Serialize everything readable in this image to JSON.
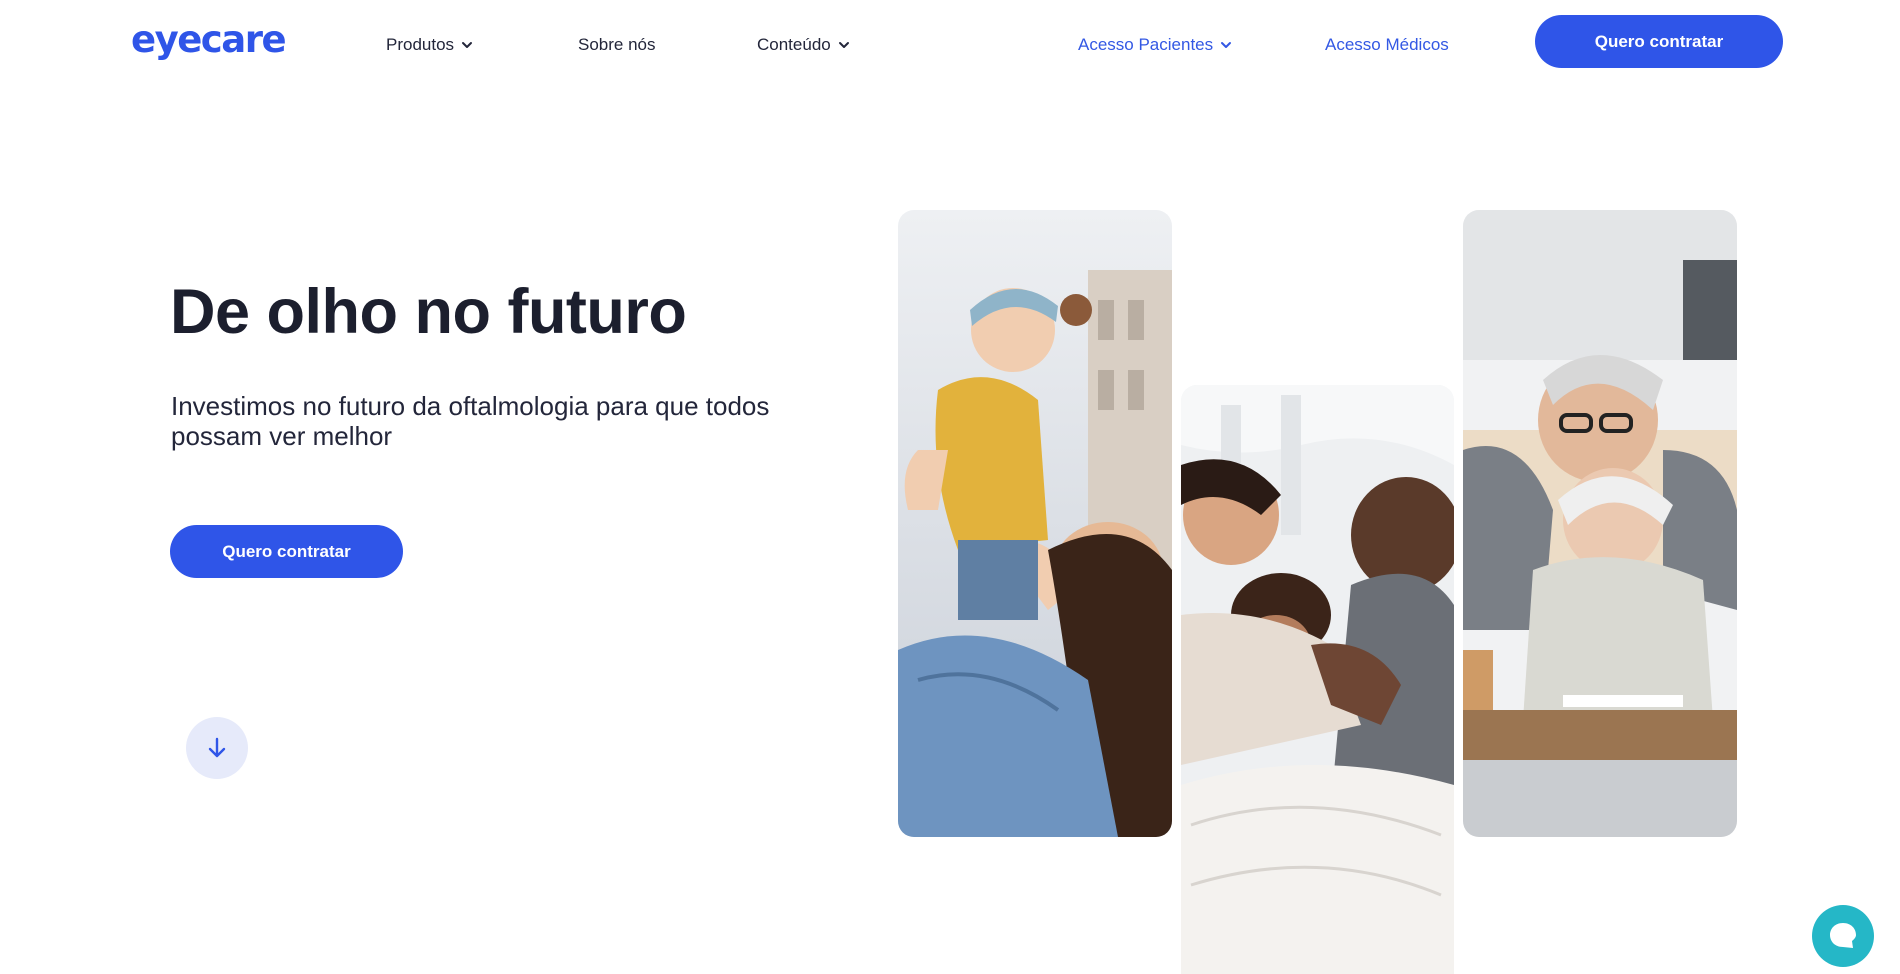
{
  "brand": {
    "logo_text": "eyecare",
    "accent": "#2f55e8",
    "chat_color": "#25b7c7"
  },
  "nav": {
    "products": "Produtos",
    "about": "Sobre nós",
    "content": "Conteúdo",
    "patients": "Acesso Pacientes",
    "doctors": "Acesso Médicos",
    "cta": "Quero contratar"
  },
  "hero": {
    "title": "De olho no futuro",
    "subtitle": "Investimos no futuro da oftalmologia para que todos possam ver melhor",
    "cta": "Quero contratar"
  },
  "icons": {
    "chevron": "chevron-down-icon",
    "scroll": "arrow-down-icon",
    "chat": "chat-bubble-icon"
  },
  "photos": [
    {
      "alt": "mother-lifting-baby-photo"
    },
    {
      "alt": "family-laughing-on-bed-photo"
    },
    {
      "alt": "grandparents-hugging-photo"
    }
  ]
}
